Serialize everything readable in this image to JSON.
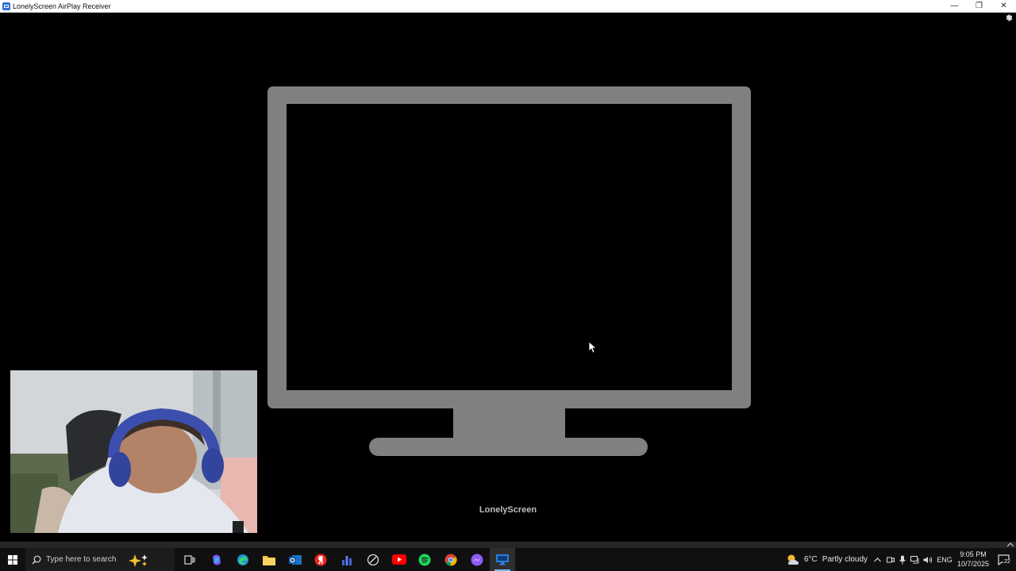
{
  "window": {
    "title": "LonelyScreen AirPlay Receiver",
    "controls": {
      "minimize": "—",
      "restore": "❐",
      "close": "✕"
    }
  },
  "app": {
    "brand_label": "LonelyScreen",
    "monitor_color": "#808080",
    "background_color": "#000000"
  },
  "taskbar": {
    "search_placeholder": "Type here to search",
    "pinned_apps": [
      "copilot-icon",
      "task-view-icon",
      "windows-copilot-icon",
      "edge-icon",
      "file-explorer-icon",
      "outlook-icon",
      "yandex-icon",
      "chart-app-icon",
      "browser-app-icon",
      "youtube-icon",
      "spotify-icon",
      "chrome-icon",
      "messenger-icon",
      "lonelyscreen-taskbar-icon"
    ],
    "weather": {
      "temperature": "6°C",
      "condition": "Partly cloudy"
    },
    "language": "ENG",
    "clock": {
      "time": "9:05 PM",
      "date": "10/7/2025"
    },
    "notification_count": "22",
    "accent_color": "#76b9ed"
  }
}
